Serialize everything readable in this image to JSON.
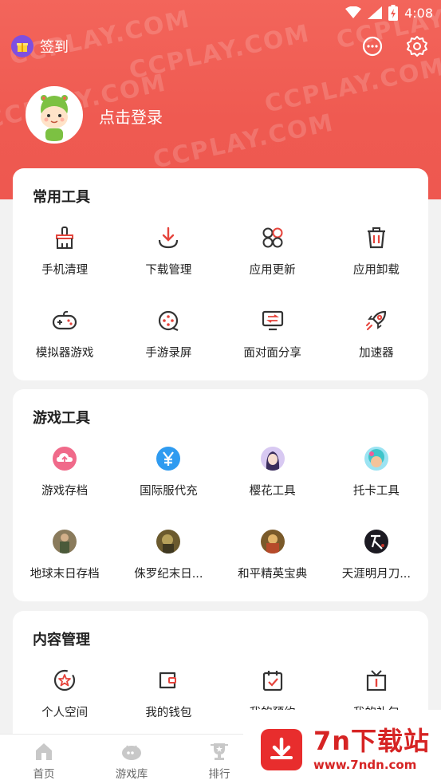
{
  "status": {
    "time": "4:08"
  },
  "header": {
    "signin_label": "签到",
    "login_label": "点击登录",
    "watermark": "CCPLAY.COM"
  },
  "common_tools": {
    "title": "常用工具",
    "items": [
      {
        "label": "手机清理",
        "icon": "broom-icon"
      },
      {
        "label": "下载管理",
        "icon": "download-icon"
      },
      {
        "label": "应用更新",
        "icon": "apps-update-icon"
      },
      {
        "label": "应用卸载",
        "icon": "trash-icon"
      },
      {
        "label": "模拟器游戏",
        "icon": "gamepad-icon"
      },
      {
        "label": "手游录屏",
        "icon": "record-icon"
      },
      {
        "label": "面对面分享",
        "icon": "share-screen-icon"
      },
      {
        "label": "加速器",
        "icon": "rocket-icon"
      }
    ]
  },
  "game_tools": {
    "title": "游戏工具",
    "items": [
      {
        "label": "游戏存档",
        "icon": "cloud-upload-icon"
      },
      {
        "label": "国际服代充",
        "icon": "yen-icon"
      },
      {
        "label": "樱花工具",
        "icon": "game-thumb-sakura"
      },
      {
        "label": "托卡工具",
        "icon": "game-thumb-toca"
      },
      {
        "label": "地球末日存档",
        "icon": "game-thumb-lastday"
      },
      {
        "label": "侏罗纪末日...",
        "icon": "game-thumb-jurassic"
      },
      {
        "label": "和平精英宝典",
        "icon": "game-thumb-peace"
      },
      {
        "label": "天涯明月刀...",
        "icon": "game-thumb-tianya"
      }
    ]
  },
  "content_mgmt": {
    "title": "内容管理",
    "items": [
      {
        "label": "个人空间",
        "icon": "star-badge-icon"
      },
      {
        "label": "我的钱包",
        "icon": "wallet-icon"
      },
      {
        "label": "我的预约",
        "icon": "calendar-check-icon"
      },
      {
        "label": "我的礼包",
        "icon": "gift-box-icon"
      }
    ]
  },
  "bottom_nav": [
    {
      "label": "首页",
      "icon": "home-icon"
    },
    {
      "label": "游戏库",
      "icon": "game-library-icon"
    },
    {
      "label": "排行",
      "icon": "trophy-icon"
    }
  ],
  "overlay_badge": {
    "title": "7n下载站",
    "url": "www.7ndn.com"
  },
  "colors": {
    "accent": "#ee5850",
    "icon_red": "#e5443c",
    "badge_red": "#d62424"
  }
}
